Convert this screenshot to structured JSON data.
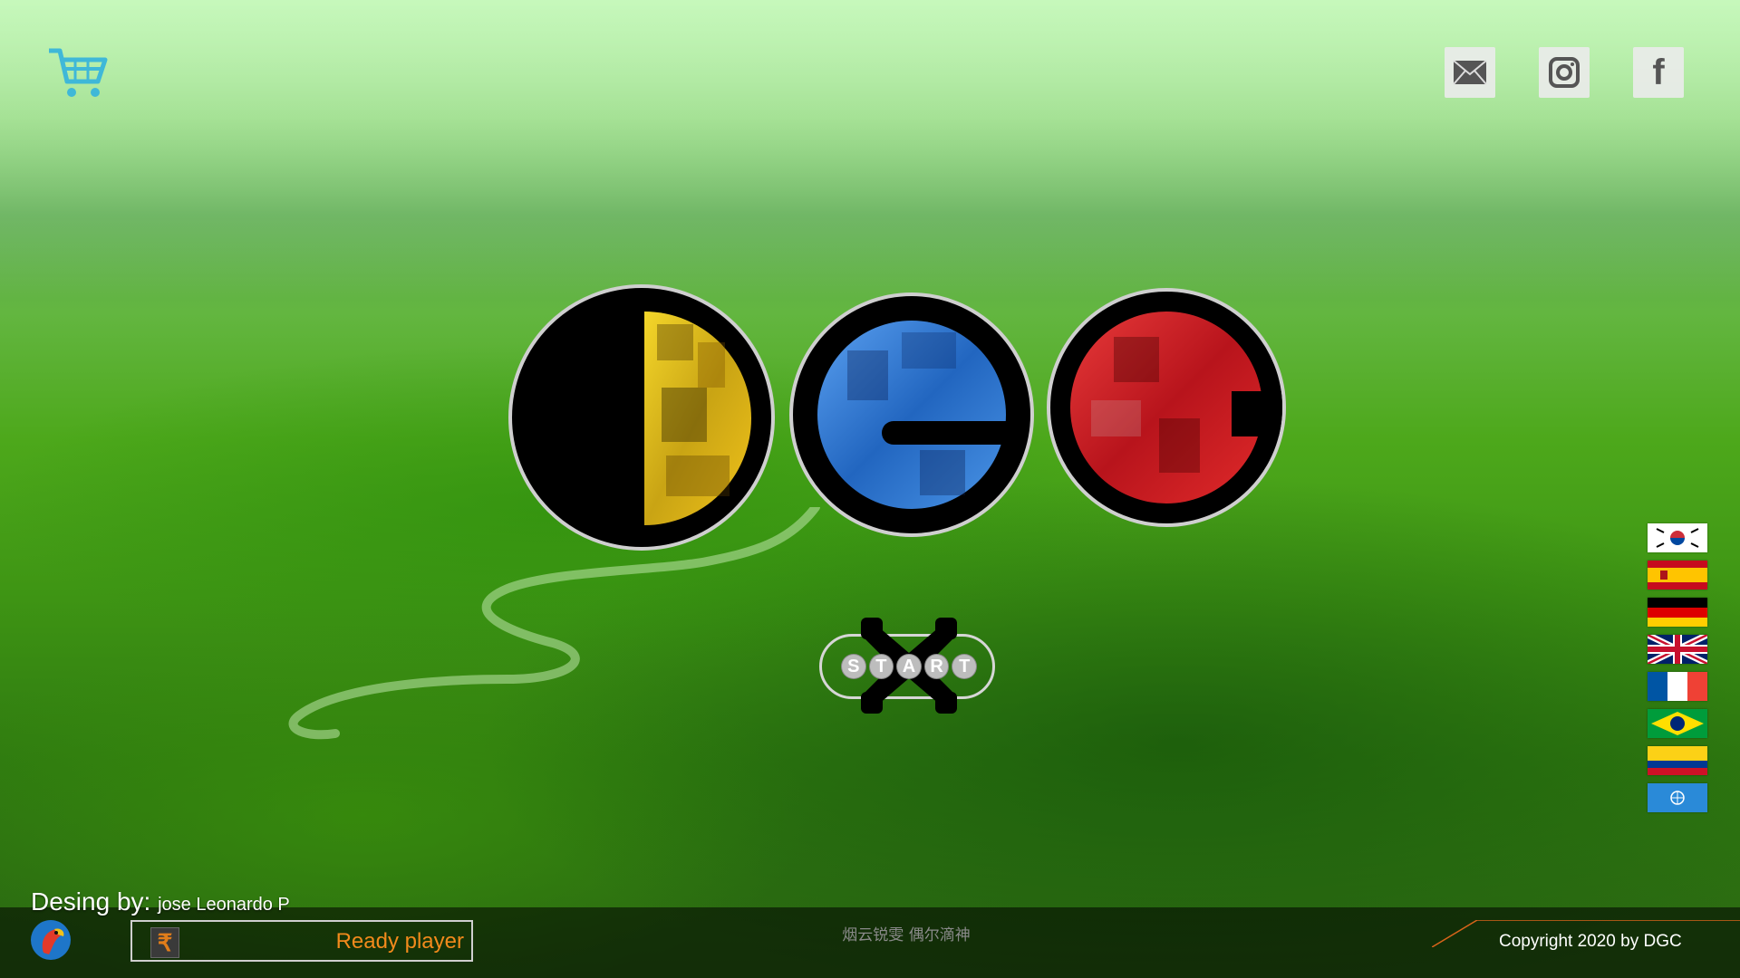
{
  "header": {
    "cart_icon": "shopping-cart-icon",
    "social": [
      {
        "name": "mail",
        "icon": "envelope-icon"
      },
      {
        "name": "instagram",
        "icon": "instagram-icon"
      },
      {
        "name": "facebook",
        "icon": "facebook-icon",
        "glyph": "f"
      }
    ]
  },
  "logo": {
    "letters": [
      "D",
      "G",
      "C"
    ],
    "colors": {
      "d": "#e8c21a",
      "g": "#2f7fd8",
      "c": "#d8202a"
    }
  },
  "start_button": {
    "letters": [
      "S",
      "T",
      "A",
      "R",
      "T"
    ]
  },
  "languages": [
    {
      "code": "ko",
      "icon": "south-korea-flag-icon"
    },
    {
      "code": "es",
      "icon": "spain-flag-icon"
    },
    {
      "code": "de",
      "icon": "germany-flag-icon"
    },
    {
      "code": "en",
      "icon": "united-kingdom-flag-icon"
    },
    {
      "code": "fr",
      "icon": "france-flag-icon"
    },
    {
      "code": "pt",
      "icon": "brazil-flag-icon"
    },
    {
      "code": "co",
      "icon": "colombia-flag-icon"
    },
    {
      "code": "un",
      "icon": "united-nations-flag-icon"
    }
  ],
  "footer": {
    "designer_label": "Desing by:",
    "designer_name": "jose Leonardo P",
    "currency_symbol": "₹",
    "ready_label": "Ready player",
    "center_text": "烟云锐雯 偶尔滴神",
    "copyright": "Copyright  2020 by DGC"
  }
}
